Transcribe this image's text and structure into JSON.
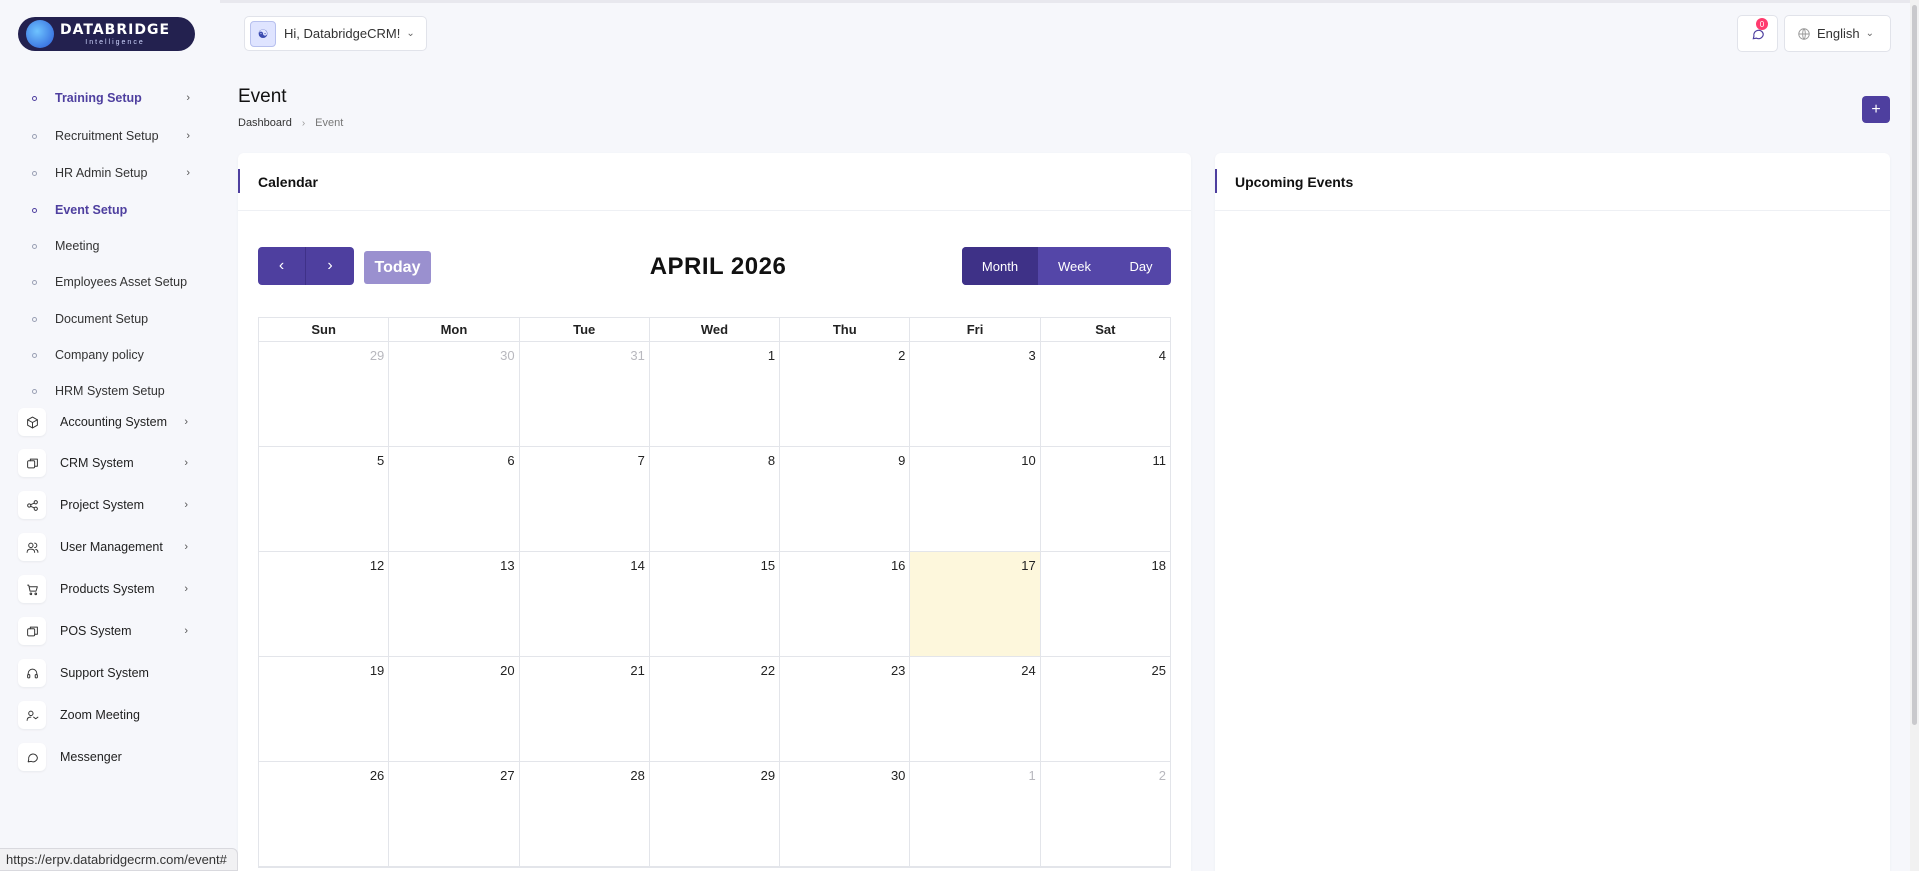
{
  "logo": {
    "name": "DATABRIDGE",
    "sub": "Intelligence"
  },
  "sidebar": {
    "sub_items": [
      {
        "label": "Training Setup",
        "active": true,
        "chevron": true
      },
      {
        "label": "Recruitment Setup",
        "active": false,
        "chevron": true
      },
      {
        "label": "HR Admin Setup",
        "active": false,
        "chevron": true
      },
      {
        "label": "Event Setup",
        "active": true,
        "chevron": false
      },
      {
        "label": "Meeting",
        "active": false,
        "chevron": false
      },
      {
        "label": "Employees Asset Setup",
        "active": false,
        "chevron": false
      },
      {
        "label": "Document Setup",
        "active": false,
        "chevron": false
      },
      {
        "label": "Company policy",
        "active": false,
        "chevron": false
      },
      {
        "label": "HRM System Setup",
        "active": false,
        "chevron": false
      }
    ],
    "main_items": [
      {
        "label": "Accounting System",
        "icon": "box-icon",
        "chevron": true
      },
      {
        "label": "CRM System",
        "icon": "layers-icon",
        "chevron": true
      },
      {
        "label": "Project System",
        "icon": "share-icon",
        "chevron": true
      },
      {
        "label": "User Management",
        "icon": "users-icon",
        "chevron": true
      },
      {
        "label": "Products System",
        "icon": "cart-icon",
        "chevron": true
      },
      {
        "label": "POS System",
        "icon": "layers-icon",
        "chevron": true
      },
      {
        "label": "Support System",
        "icon": "headset-icon",
        "chevron": false
      },
      {
        "label": "Zoom Meeting",
        "icon": "user-video-icon",
        "chevron": false
      },
      {
        "label": "Messenger",
        "icon": "chat-icon",
        "chevron": false
      }
    ]
  },
  "header": {
    "greeting": "Hi, DatabridgeCRM!",
    "notifications_count": "0",
    "language": "English"
  },
  "page": {
    "title": "Event",
    "breadcrumb": [
      "Dashboard",
      "Event"
    ],
    "add_label": "+"
  },
  "calendar": {
    "title": "Calendar",
    "today_label": "Today",
    "month_label": "APRIL 2026",
    "views": [
      "Month",
      "Week",
      "Day"
    ],
    "active_view": "Month",
    "weekdays": [
      "Sun",
      "Mon",
      "Tue",
      "Wed",
      "Thu",
      "Fri",
      "Sat"
    ],
    "weeks": [
      [
        [
          "29",
          true
        ],
        [
          "30",
          true
        ],
        [
          "31",
          true
        ],
        [
          "1",
          false
        ],
        [
          "2",
          false
        ],
        [
          "3",
          false
        ],
        [
          "4",
          false
        ]
      ],
      [
        [
          "5",
          false
        ],
        [
          "6",
          false
        ],
        [
          "7",
          false
        ],
        [
          "8",
          false
        ],
        [
          "9",
          false
        ],
        [
          "10",
          false
        ],
        [
          "11",
          false
        ]
      ],
      [
        [
          "12",
          false
        ],
        [
          "13",
          false
        ],
        [
          "14",
          false
        ],
        [
          "15",
          false
        ],
        [
          "16",
          false
        ],
        [
          "17",
          false
        ],
        [
          "18",
          false
        ]
      ],
      [
        [
          "19",
          false
        ],
        [
          "20",
          false
        ],
        [
          "21",
          false
        ],
        [
          "22",
          false
        ],
        [
          "23",
          false
        ],
        [
          "24",
          false
        ],
        [
          "25",
          false
        ]
      ],
      [
        [
          "26",
          false
        ],
        [
          "27",
          false
        ],
        [
          "28",
          false
        ],
        [
          "29",
          false
        ],
        [
          "30",
          false
        ],
        [
          "1",
          true
        ],
        [
          "2",
          true
        ]
      ]
    ],
    "today_day": "17"
  },
  "upcoming": {
    "title": "Upcoming Events"
  },
  "status_url": "https://erpv.databridgecrm.com/event#",
  "colors": {
    "accent": "#4e3f9f",
    "today_bg": "#fdf7dc",
    "badge": "#ff3a6e"
  }
}
